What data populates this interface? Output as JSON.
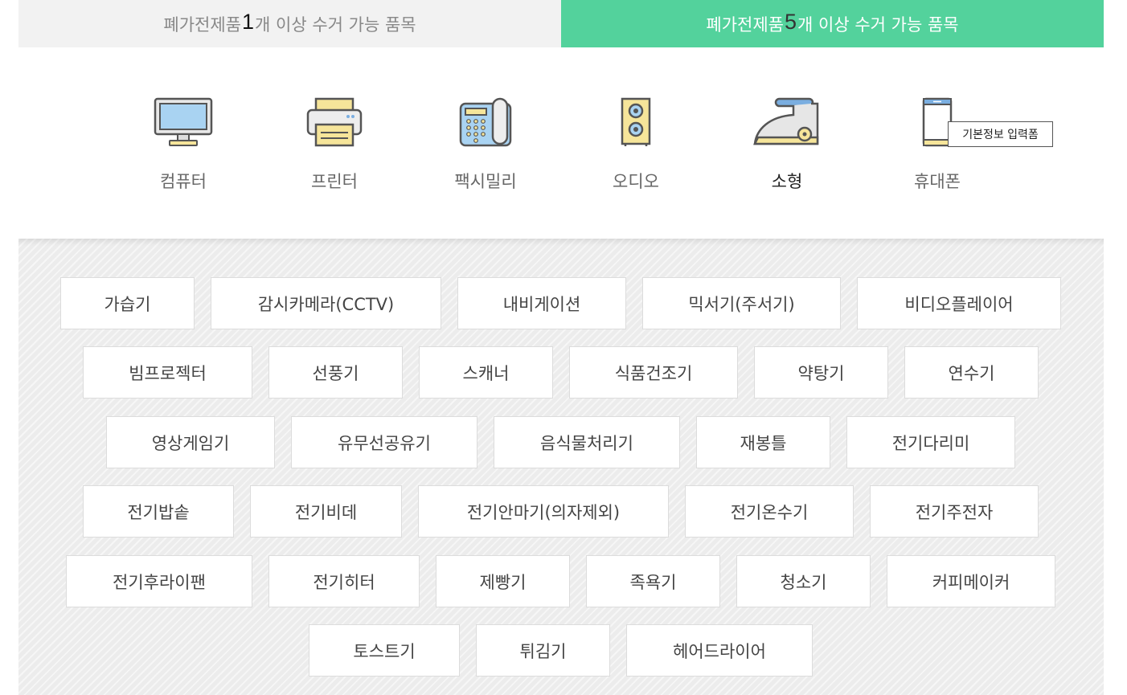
{
  "tabs": [
    {
      "prefix": "폐가전제품 ",
      "num": "1",
      "suffix": "개 이상 수거 가능 품목"
    },
    {
      "prefix": "폐가전제품 ",
      "num": "5",
      "suffix": "개 이상 수거 가능 품목"
    }
  ],
  "categories": [
    {
      "label": "컴퓨터",
      "icon": "monitor-icon"
    },
    {
      "label": "프린터",
      "icon": "printer-icon"
    },
    {
      "label": "팩시밀리",
      "icon": "fax-icon"
    },
    {
      "label": "오디오",
      "icon": "speaker-icon"
    },
    {
      "label": "소형",
      "icon": "iron-icon"
    },
    {
      "label": "휴대폰",
      "icon": "mobile-phone-icon"
    }
  ],
  "tooltip": "기본정보 입력폼",
  "items": [
    [
      "가습기",
      "감시카메라(CCTV)",
      "내비게이션",
      "믹서기(주서기)",
      "비디오플레이어"
    ],
    [
      "빔프로젝터",
      "선풍기",
      "스캐너",
      "식품건조기",
      "약탕기",
      "연수기"
    ],
    [
      "영상게임기",
      "유무선공유기",
      "음식물처리기",
      "재봉틀",
      "전기다리미"
    ],
    [
      "전기밥솥",
      "전기비데",
      "전기안마기(의자제외)",
      "전기온수기",
      "전기주전자"
    ],
    [
      "전기후라이팬",
      "전기히터",
      "제빵기",
      "족욕기",
      "청소기",
      "커피메이커"
    ],
    [
      "토스트기",
      "튀김기",
      "헤어드라이어"
    ]
  ],
  "colors": {
    "accent": "#53d29c",
    "highlight": "#6fe0b3"
  }
}
